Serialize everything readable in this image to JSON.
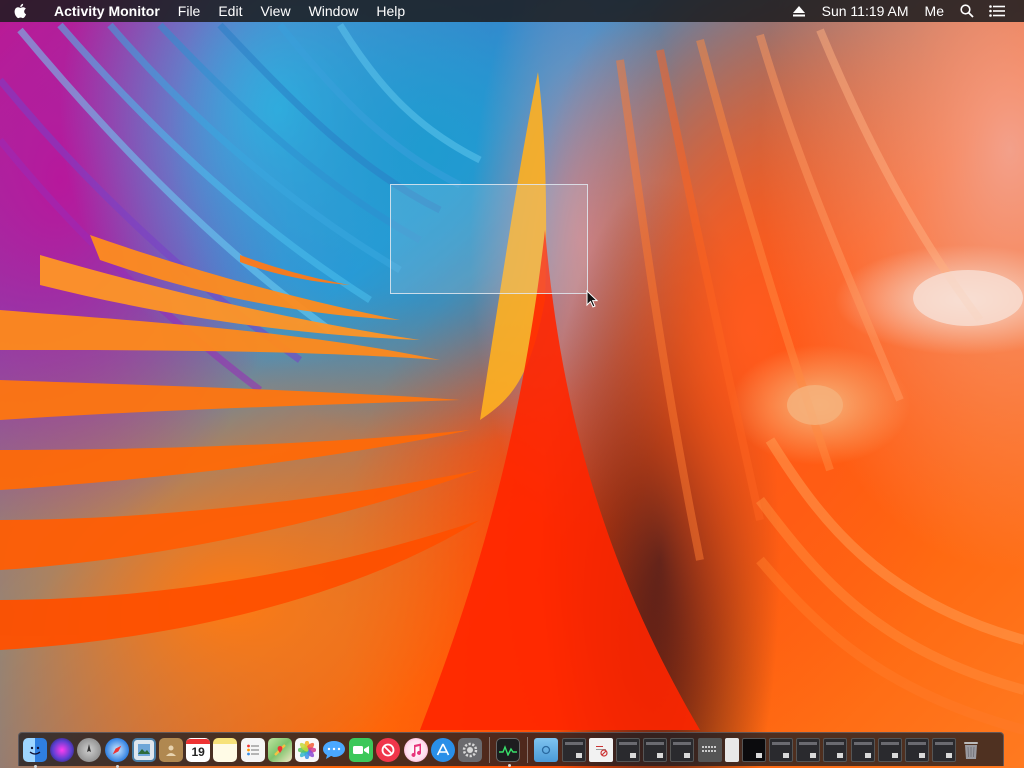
{
  "menubar": {
    "app_name": "Activity Monitor",
    "menus": [
      "File",
      "Edit",
      "View",
      "Window",
      "Help"
    ],
    "clock": "Sun 11:19 AM",
    "user": "Me"
  },
  "dock": {
    "calendar_day": "19",
    "apps": [
      {
        "name": "finder-icon",
        "color": "#3a8ee6"
      },
      {
        "name": "siri-icon",
        "color": "#6b3fd1"
      },
      {
        "name": "launchpad-icon",
        "color": "#8a8a8a"
      },
      {
        "name": "safari-icon",
        "color": "#2f7fe0"
      },
      {
        "name": "preview-icon",
        "color": "#4a7fa8"
      },
      {
        "name": "contacts-icon",
        "color": "#b08850"
      },
      {
        "name": "calendar-icon",
        "color": "#ffffff"
      },
      {
        "name": "notes-icon",
        "color": "#f5e06a"
      },
      {
        "name": "reminders-icon",
        "color": "#f2f2f2"
      },
      {
        "name": "maps-icon",
        "color": "#7cc26a"
      },
      {
        "name": "photos-icon",
        "color": "#f0f0f0"
      },
      {
        "name": "messages-icon",
        "color": "#4aa8ff"
      },
      {
        "name": "facetime-icon",
        "color": "#3cc85a"
      },
      {
        "name": "news-icon",
        "color": "#f0364b"
      },
      {
        "name": "itunes-icon",
        "color": "#f35e9a"
      },
      {
        "name": "app-store-icon",
        "color": "#2a8fe8"
      },
      {
        "name": "system-preferences-icon",
        "color": "#7a7a7a"
      }
    ]
  }
}
